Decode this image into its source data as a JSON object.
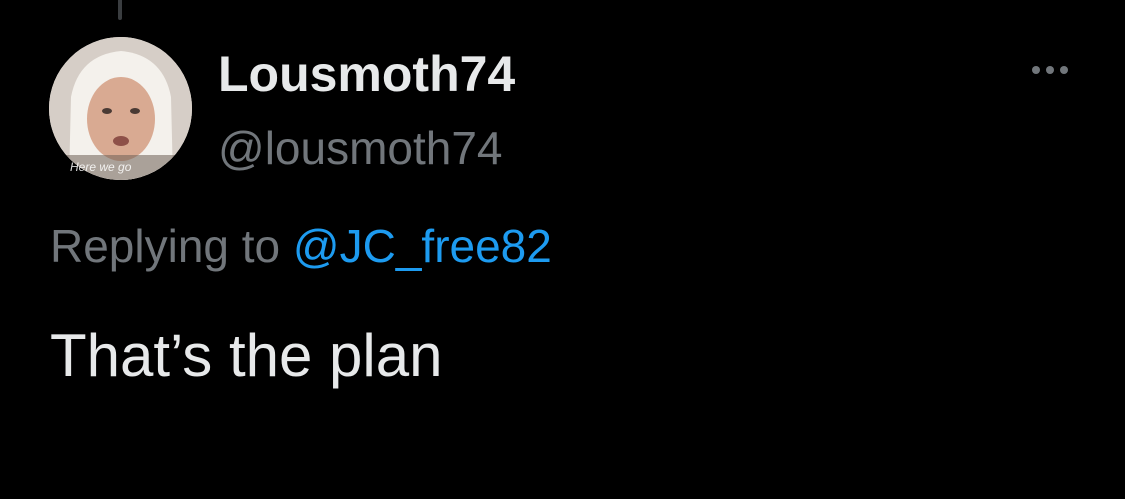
{
  "tweet": {
    "author": {
      "display_name": "Lousmoth74",
      "handle": "@lousmoth74",
      "avatar_caption": "Here we go"
    },
    "reply_prefix": "Replying to",
    "reply_to": "@JC_free82",
    "text": "That’s the plan"
  },
  "icons": {
    "more": "more-horizontal-icon"
  },
  "colors": {
    "background": "#000000",
    "primary_text": "#e7e9ea",
    "secondary_text": "#71767b",
    "link": "#1d9bf0"
  }
}
